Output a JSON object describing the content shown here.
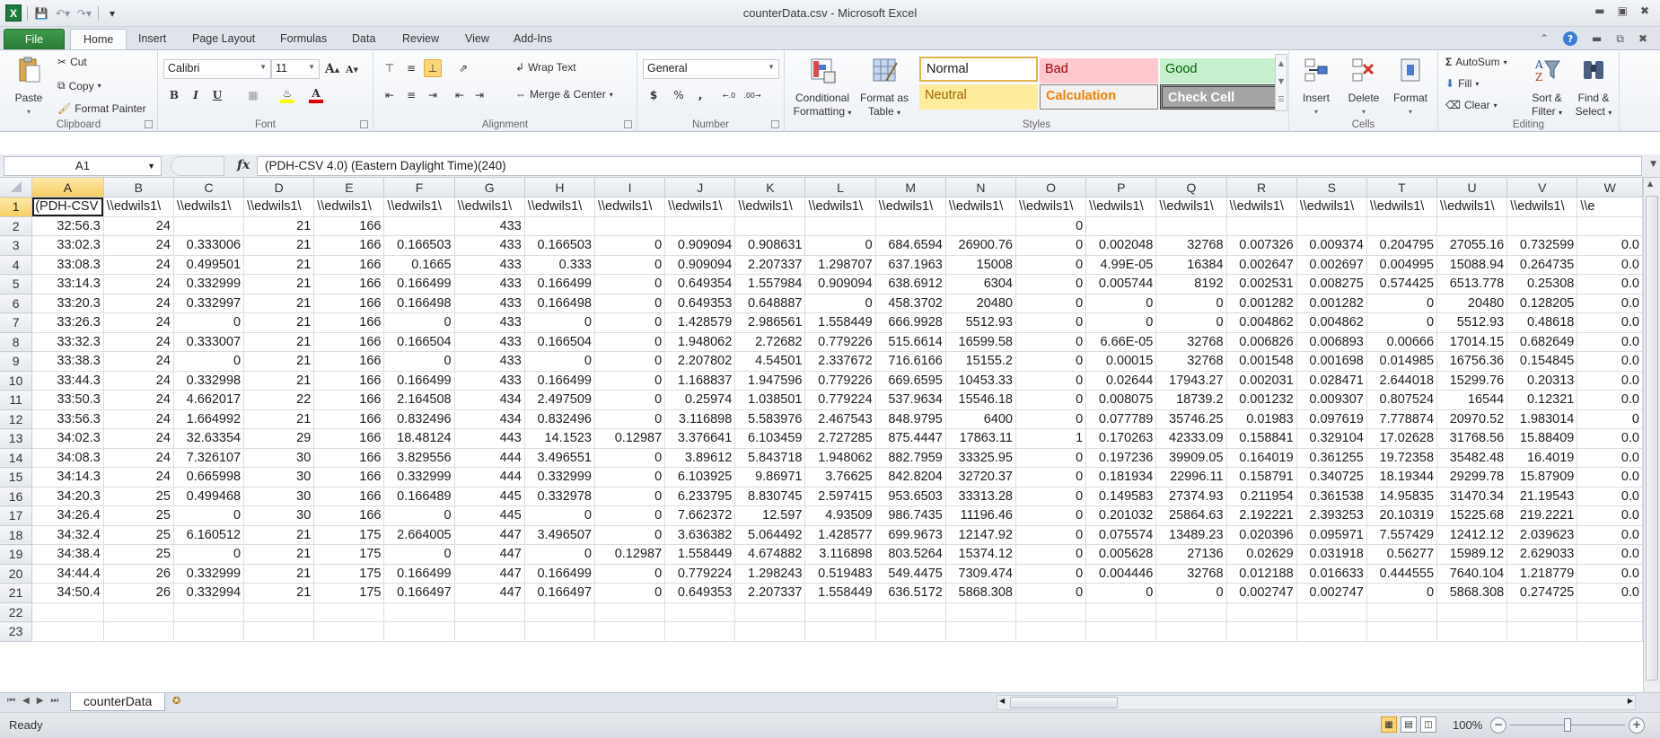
{
  "window": {
    "title": "counterData.csv  -  Microsoft Excel",
    "app_icon_label": "X"
  },
  "ribbon_tabs": [
    "File",
    "Home",
    "Insert",
    "Page Layout",
    "Formulas",
    "Data",
    "Review",
    "View",
    "Add-Ins"
  ],
  "active_tab": "Home",
  "ribbon": {
    "clipboard": {
      "label": "Clipboard",
      "paste": "Paste",
      "cut": "Cut",
      "copy": "Copy",
      "format_painter": "Format Painter"
    },
    "font": {
      "label": "Font",
      "family": "Calibri",
      "size": "11",
      "bold": "B",
      "italic": "I",
      "underline": "U",
      "highlight_color": "#ffff00",
      "font_color": "#e00000"
    },
    "alignment": {
      "label": "Alignment",
      "wrap_text": "Wrap Text",
      "merge_center": "Merge & Center"
    },
    "number": {
      "label": "Number",
      "format": "General",
      "currency": "$",
      "percent": "%",
      "comma": ",",
      "inc_decimal": "←.0 .00",
      "dec_decimal": ".00 →.0"
    },
    "styles": {
      "label": "Styles",
      "conditional_formatting": [
        "Conditional",
        "Formatting"
      ],
      "format_as_table": [
        "Format as",
        "Table"
      ],
      "cell_styles": [
        {
          "name": "Normal",
          "bg": "#ffffff",
          "fg": "#000000"
        },
        {
          "name": "Bad",
          "bg": "#ffc7ce",
          "fg": "#9c0006"
        },
        {
          "name": "Good",
          "bg": "#c6efce",
          "fg": "#006100"
        },
        {
          "name": "Neutral",
          "bg": "#ffeb9c",
          "fg": "#9c6500"
        },
        {
          "name": "Calculation",
          "bg": "#f2f2f2",
          "fg": "#fa7d00"
        },
        {
          "name": "Check Cell",
          "bg": "#a5a5a5",
          "fg": "#ffffff"
        }
      ]
    },
    "cells": {
      "label": "Cells",
      "insert": "Insert",
      "delete": "Delete",
      "format": "Format"
    },
    "editing": {
      "label": "Editing",
      "autosum": "AutoSum",
      "fill": "Fill",
      "clear": "Clear",
      "sort_filter": [
        "Sort &",
        "Filter"
      ],
      "find_select": [
        "Find &",
        "Select"
      ]
    }
  },
  "formula_bar": {
    "name_box": "A1",
    "fx": "fx",
    "value": "(PDH-CSV 4.0) (Eastern Daylight Time)(240)"
  },
  "sheet": {
    "columns": [
      "A",
      "B",
      "C",
      "D",
      "E",
      "F",
      "G",
      "H",
      "I",
      "J",
      "K",
      "L",
      "M",
      "N",
      "O",
      "P",
      "Q",
      "R",
      "S",
      "T",
      "U",
      "V",
      "W"
    ],
    "selected_cell": "A1",
    "rows": [
      [
        "(PDH-CSV",
        "\\\\edwils1\\",
        "\\\\edwils1\\",
        "\\\\edwils1\\",
        "\\\\edwils1\\",
        "\\\\edwils1\\",
        "\\\\edwils1\\",
        "\\\\edwils1\\",
        "\\\\edwils1\\",
        "\\\\edwils1\\",
        "\\\\edwils1\\",
        "\\\\edwils1\\",
        "\\\\edwils1\\",
        "\\\\edwils1\\",
        "\\\\edwils1\\",
        "\\\\edwils1\\",
        "\\\\edwils1\\",
        "\\\\edwils1\\",
        "\\\\edwils1\\",
        "\\\\edwils1\\",
        "\\\\edwils1\\",
        "\\\\edwils1\\",
        "\\\\e"
      ],
      [
        "32:56.3",
        "24",
        "",
        "21",
        "166",
        "",
        "433",
        "",
        "",
        "",
        "",
        "",
        "",
        "",
        "0",
        "",
        "",
        "",
        "",
        "",
        "",
        "",
        ""
      ],
      [
        "33:02.3",
        "24",
        "0.333006",
        "21",
        "166",
        "0.166503",
        "433",
        "0.166503",
        "0",
        "0.909094",
        "0.908631",
        "0",
        "684.6594",
        "26900.76",
        "0",
        "0.002048",
        "32768",
        "0.007326",
        "0.009374",
        "0.204795",
        "27055.16",
        "0.732599",
        "0.0"
      ],
      [
        "33:08.3",
        "24",
        "0.499501",
        "21",
        "166",
        "0.1665",
        "433",
        "0.333",
        "0",
        "0.909094",
        "2.207337",
        "1.298707",
        "637.1963",
        "15008",
        "0",
        "4.99E-05",
        "16384",
        "0.002647",
        "0.002697",
        "0.004995",
        "15088.94",
        "0.264735",
        "0.0"
      ],
      [
        "33:14.3",
        "24",
        "0.332999",
        "21",
        "166",
        "0.166499",
        "433",
        "0.166499",
        "0",
        "0.649354",
        "1.557984",
        "0.909094",
        "638.6912",
        "6304",
        "0",
        "0.005744",
        "8192",
        "0.002531",
        "0.008275",
        "0.574425",
        "6513.778",
        "0.25308",
        "0.0"
      ],
      [
        "33:20.3",
        "24",
        "0.332997",
        "21",
        "166",
        "0.166498",
        "433",
        "0.166498",
        "0",
        "0.649353",
        "0.648887",
        "0",
        "458.3702",
        "20480",
        "0",
        "0",
        "0",
        "0.001282",
        "0.001282",
        "0",
        "20480",
        "0.128205",
        "0.0"
      ],
      [
        "33:26.3",
        "24",
        "0",
        "21",
        "166",
        "0",
        "433",
        "0",
        "0",
        "1.428579",
        "2.986561",
        "1.558449",
        "666.9928",
        "5512.93",
        "0",
        "0",
        "0",
        "0.004862",
        "0.004862",
        "0",
        "5512.93",
        "0.48618",
        "0.0"
      ],
      [
        "33:32.3",
        "24",
        "0.333007",
        "21",
        "166",
        "0.166504",
        "433",
        "0.166504",
        "0",
        "1.948062",
        "2.72682",
        "0.779226",
        "515.6614",
        "16599.58",
        "0",
        "6.66E-05",
        "32768",
        "0.006826",
        "0.006893",
        "0.00666",
        "17014.15",
        "0.682649",
        "0.0"
      ],
      [
        "33:38.3",
        "24",
        "0",
        "21",
        "166",
        "0",
        "433",
        "0",
        "0",
        "2.207802",
        "4.54501",
        "2.337672",
        "716.6166",
        "15155.2",
        "0",
        "0.00015",
        "32768",
        "0.001548",
        "0.001698",
        "0.014985",
        "16756.36",
        "0.154845",
        "0.0"
      ],
      [
        "33:44.3",
        "24",
        "0.332998",
        "21",
        "166",
        "0.166499",
        "433",
        "0.166499",
        "0",
        "1.168837",
        "1.947596",
        "0.779226",
        "669.6595",
        "10453.33",
        "0",
        "0.02644",
        "17943.27",
        "0.002031",
        "0.028471",
        "2.644018",
        "15299.76",
        "0.20313",
        "0.0"
      ],
      [
        "33:50.3",
        "24",
        "4.662017",
        "22",
        "166",
        "2.164508",
        "434",
        "2.497509",
        "0",
        "0.25974",
        "1.038501",
        "0.779224",
        "537.9634",
        "15546.18",
        "0",
        "0.008075",
        "18739.2",
        "0.001232",
        "0.009307",
        "0.807524",
        "16544",
        "0.12321",
        "0.0"
      ],
      [
        "33:56.3",
        "24",
        "1.664992",
        "21",
        "166",
        "0.832496",
        "434",
        "0.832496",
        "0",
        "3.116898",
        "5.583976",
        "2.467543",
        "848.9795",
        "6400",
        "0",
        "0.077789",
        "35746.25",
        "0.01983",
        "0.097619",
        "7.778874",
        "20970.52",
        "1.983014",
        "0"
      ],
      [
        "34:02.3",
        "24",
        "32.63354",
        "29",
        "166",
        "18.48124",
        "443",
        "14.1523",
        "0.12987",
        "3.376641",
        "6.103459",
        "2.727285",
        "875.4447",
        "17863.11",
        "1",
        "0.170263",
        "42333.09",
        "0.158841",
        "0.329104",
        "17.02628",
        "31768.56",
        "15.88409",
        "0.0"
      ],
      [
        "34:08.3",
        "24",
        "7.326107",
        "30",
        "166",
        "3.829556",
        "444",
        "3.496551",
        "0",
        "3.89612",
        "5.843718",
        "1.948062",
        "882.7959",
        "33325.95",
        "0",
        "0.197236",
        "39909.05",
        "0.164019",
        "0.361255",
        "19.72358",
        "35482.48",
        "16.4019",
        "0.0"
      ],
      [
        "34:14.3",
        "24",
        "0.665998",
        "30",
        "166",
        "0.332999",
        "444",
        "0.332999",
        "0",
        "6.103925",
        "9.86971",
        "3.76625",
        "842.8204",
        "32720.37",
        "0",
        "0.181934",
        "22996.11",
        "0.158791",
        "0.340725",
        "18.19344",
        "29299.78",
        "15.87909",
        "0.0"
      ],
      [
        "34:20.3",
        "25",
        "0.499468",
        "30",
        "166",
        "0.166489",
        "445",
        "0.332978",
        "0",
        "6.233795",
        "8.830745",
        "2.597415",
        "953.6503",
        "33313.28",
        "0",
        "0.149583",
        "27374.93",
        "0.211954",
        "0.361538",
        "14.95835",
        "31470.34",
        "21.19543",
        "0.0"
      ],
      [
        "34:26.4",
        "25",
        "0",
        "30",
        "166",
        "0",
        "445",
        "0",
        "0",
        "7.662372",
        "12.597",
        "4.93509",
        "986.7435",
        "11196.46",
        "0",
        "0.201032",
        "25864.63",
        "2.192221",
        "2.393253",
        "20.10319",
        "15225.68",
        "219.2221",
        "0.0"
      ],
      [
        "34:32.4",
        "25",
        "6.160512",
        "21",
        "175",
        "2.664005",
        "447",
        "3.496507",
        "0",
        "3.636382",
        "5.064492",
        "1.428577",
        "699.9673",
        "12147.92",
        "0",
        "0.075574",
        "13489.23",
        "0.020396",
        "0.095971",
        "7.557429",
        "12412.12",
        "2.039623",
        "0.0"
      ],
      [
        "34:38.4",
        "25",
        "0",
        "21",
        "175",
        "0",
        "447",
        "0",
        "0.12987",
        "1.558449",
        "4.674882",
        "3.116898",
        "803.5264",
        "15374.12",
        "0",
        "0.005628",
        "27136",
        "0.02629",
        "0.031918",
        "0.56277",
        "15989.12",
        "2.629033",
        "0.0"
      ],
      [
        "34:44.4",
        "26",
        "0.332999",
        "21",
        "175",
        "0.166499",
        "447",
        "0.166499",
        "0",
        "0.779224",
        "1.298243",
        "0.519483",
        "549.4475",
        "7309.474",
        "0",
        "0.004446",
        "32768",
        "0.012188",
        "0.016633",
        "0.444555",
        "7640.104",
        "1.218779",
        "0.0"
      ],
      [
        "34:50.4",
        "26",
        "0.332994",
        "21",
        "175",
        "0.166497",
        "447",
        "0.166497",
        "0",
        "0.649353",
        "2.207337",
        "1.558449",
        "636.5172",
        "5868.308",
        "0",
        "0",
        "0",
        "0.002747",
        "0.002747",
        "0",
        "5868.308",
        "0.274725",
        "0.0"
      ],
      [
        "",
        "",
        "",
        "",
        "",
        "",
        "",
        "",
        "",
        "",
        "",
        "",
        "",
        "",
        "",
        "",
        "",
        "",
        "",
        "",
        "",
        "",
        ""
      ],
      [
        "",
        "",
        "",
        "",
        "",
        "",
        "",
        "",
        "",
        "",
        "",
        "",
        "",
        "",
        "",
        "",
        "",
        "",
        "",
        "",
        "",
        "",
        ""
      ]
    ]
  },
  "sheet_tabs": [
    "counterData"
  ],
  "status": {
    "text": "Ready",
    "zoom": "100%",
    "zoom_percent": 100
  }
}
